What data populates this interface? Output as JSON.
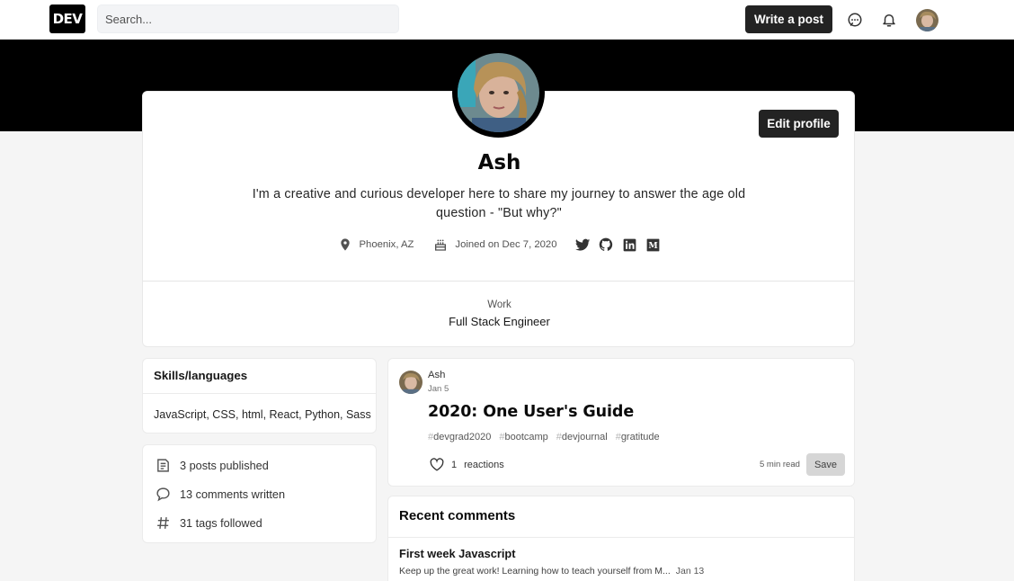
{
  "header": {
    "logo_text": "DEV",
    "search_placeholder": "Search...",
    "write_button": "Write a post",
    "icons": [
      "chat-icon",
      "bell-icon",
      "user-avatar"
    ]
  },
  "profile": {
    "name": "Ash",
    "bio": "I'm a creative and curious developer here to share my journey to answer the age old question - \"But why?\"",
    "location": "Phoenix, AZ",
    "joined": "Joined on Dec 7, 2020",
    "social_icons": [
      "twitter-icon",
      "github-icon",
      "linkedin-icon",
      "medium-icon"
    ],
    "edit_button": "Edit profile",
    "work_label": "Work",
    "work_value": "Full Stack Engineer"
  },
  "sidebar": {
    "skills_heading": "Skills/languages",
    "skills": "JavaScript, CSS, html, React, Python, Sass",
    "stats": [
      {
        "icon": "post-icon",
        "label": "3 posts published"
      },
      {
        "icon": "comment-icon",
        "label": "13 comments written"
      },
      {
        "icon": "hashtag-icon",
        "label": "31 tags followed"
      }
    ]
  },
  "posts": [
    {
      "author": "Ash",
      "date": "Jan 5",
      "title": "2020: One User's Guide",
      "tags": [
        "devgrad2020",
        "bootcamp",
        "devjournal",
        "gratitude"
      ],
      "reactions_count": "1",
      "reactions_label": "reactions",
      "read_time": "5 min read",
      "save_label": "Save"
    }
  ],
  "recent_comments": {
    "heading": "Recent comments",
    "items": [
      {
        "title": "First week Javascript",
        "excerpt": "Keep up the great work! Learning how to teach yourself from M...",
        "date": "Jan 13"
      }
    ]
  },
  "colors": {
    "accent_dark": "#232323",
    "banner": "#000000",
    "background": "#f5f5f5"
  }
}
